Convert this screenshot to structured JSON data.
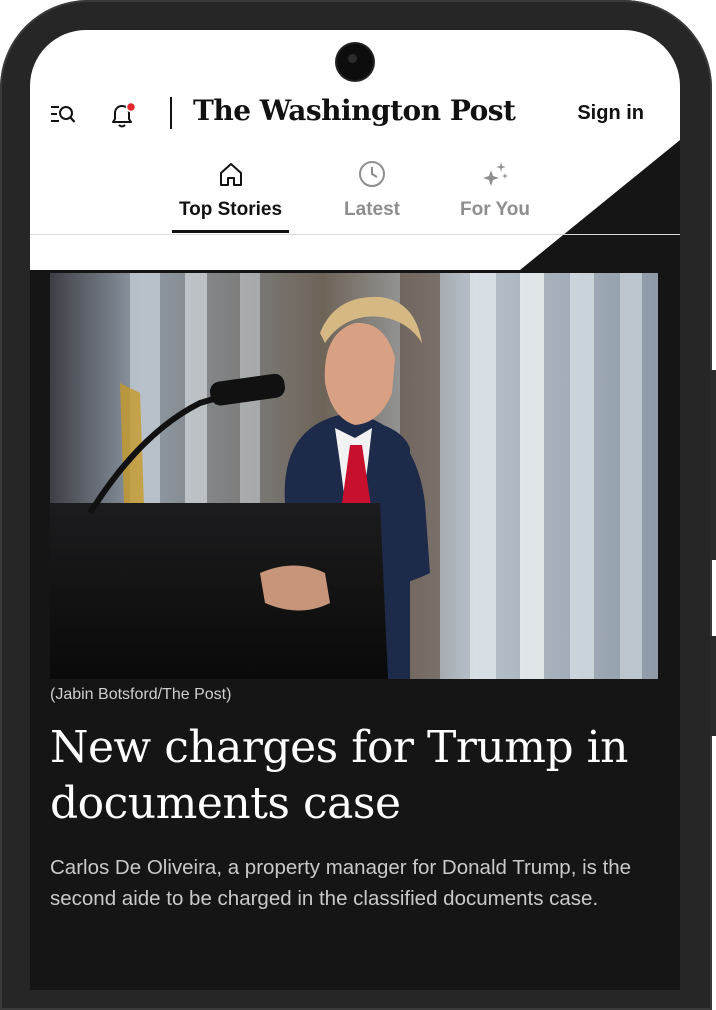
{
  "header": {
    "logo_text": "The Washington Post",
    "sign_in_label": "Sign in",
    "menu_icon": "menu-search-icon",
    "notification_icon": "bell-icon",
    "notification_dot_color": "#e4272b"
  },
  "tabs": [
    {
      "label": "Top Stories",
      "icon": "home-icon",
      "active": true
    },
    {
      "label": "Latest",
      "icon": "clock-icon",
      "active": false
    },
    {
      "label": "For You",
      "icon": "sparkle-icon",
      "active": false
    }
  ],
  "article": {
    "photo_credit": "(Jabin Botsford/The Post)",
    "headline": "New charges for Trump in documents case",
    "summary": "Carlos De Oliveira, a property manager for Donald Trump, is the second aide to be charged in the classified documents case."
  },
  "colors": {
    "screen_bg": "#151515",
    "header_bg": "#ffffff",
    "phone_frame": "#262626",
    "tie_red": "#c8102e",
    "suit_navy": "#1d2a4a"
  }
}
